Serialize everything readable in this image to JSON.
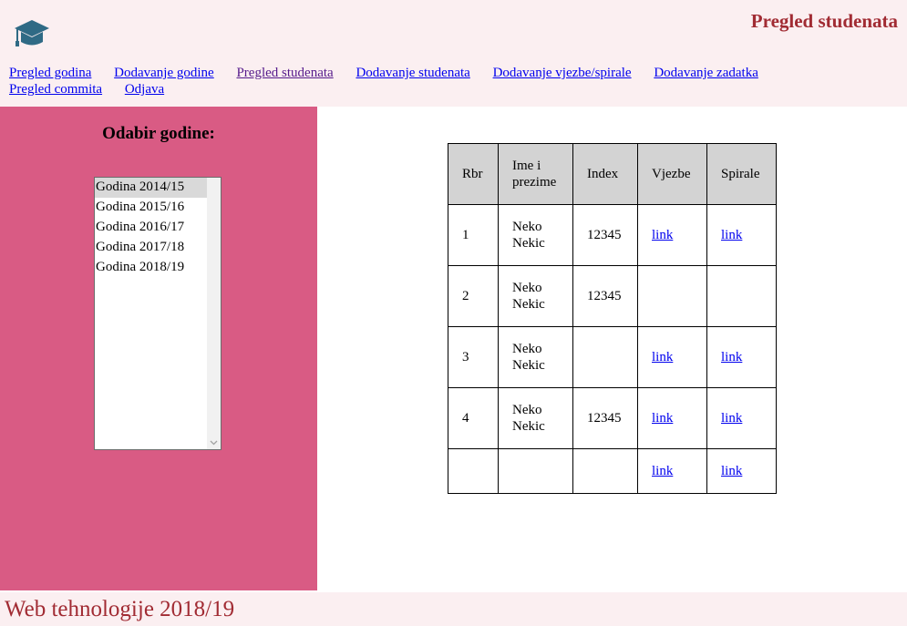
{
  "header": {
    "logo_icon": "graduation-cap-icon",
    "title": "Pregled studenata"
  },
  "nav": {
    "items": [
      {
        "label": "Pregled godina"
      },
      {
        "label": "Dodavanje godine"
      },
      {
        "label": "Pregled studenata"
      },
      {
        "label": "Dodavanje studenata"
      },
      {
        "label": "Dodavanje vjezbe/spirale"
      },
      {
        "label": "Dodavanje zadatka"
      },
      {
        "label": "Pregled commita"
      },
      {
        "label": "Odjava"
      }
    ]
  },
  "sidebar": {
    "title": "Odabir godine:",
    "years": [
      "Godina 2014/15",
      "Godina 2015/16",
      "Godina 2016/17",
      "Godina 2017/18",
      "Godina 2018/19"
    ],
    "selected_year": "Godina 2014/15"
  },
  "table": {
    "headers": {
      "rbr": "Rbr",
      "name": "Ime i prezime",
      "index": "Index",
      "vjezbe": "Vjezbe",
      "spirale": "Spirale"
    },
    "rows": [
      {
        "rbr": "1",
        "name": "Neko Nekic",
        "index": "12345",
        "vjezbe": "link",
        "spirale": "link"
      },
      {
        "rbr": "2",
        "name": "Neko Nekic",
        "index": "12345",
        "vjezbe": "",
        "spirale": ""
      },
      {
        "rbr": "3",
        "name": "Neko Nekic",
        "index": "",
        "vjezbe": "link",
        "spirale": "link"
      },
      {
        "rbr": "4",
        "name": "Neko Nekic",
        "index": "12345",
        "vjezbe": "link",
        "spirale": "link"
      },
      {
        "rbr": "",
        "name": "",
        "index": "",
        "vjezbe": "link",
        "spirale": "link"
      }
    ]
  },
  "footer": {
    "text": "Web tehnologije 2018/19"
  },
  "colors": {
    "header_bg": "#fbeff1",
    "title_color": "#a12b33",
    "sidebar_bg": "#d95b84",
    "table_header_bg": "#d3d3d3",
    "link": "#0000ee",
    "visited_link": "#551a8b",
    "logo": "#2f6a85"
  }
}
